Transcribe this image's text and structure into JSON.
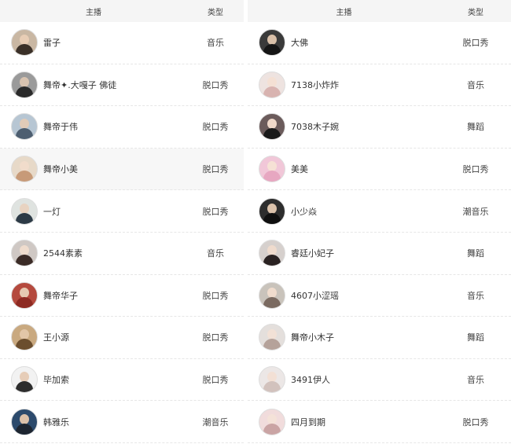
{
  "left_table": {
    "header": {
      "host": "主播",
      "type": "类型"
    },
    "rows": [
      {
        "name": "雷子",
        "type": "音乐",
        "avatar": {
          "bg": "#c9b7a3",
          "skin": "#e8cdb5",
          "cloth": "#3a3028"
        }
      },
      {
        "name": "舞帝✦.大嘎子 佛徒",
        "type": "脱口秀",
        "avatar": {
          "bg": "#9a9a9a",
          "skin": "#d8c3b0",
          "cloth": "#2a2a2a"
        }
      },
      {
        "name": "舞帝于伟",
        "type": "脱口秀",
        "avatar": {
          "bg": "#b7c6d3",
          "skin": "#e1cbb8",
          "cloth": "#4d5e70"
        }
      },
      {
        "name": "舞帝小美",
        "type": "脱口秀",
        "avatar": {
          "bg": "#e7d9c8",
          "skin": "#f1dccb",
          "cloth": "#c79a78"
        }
      },
      {
        "name": "一灯",
        "type": "脱口秀",
        "avatar": {
          "bg": "#dfe3e0",
          "skin": "#e8d3c1",
          "cloth": "#2c3a46"
        }
      },
      {
        "name": "2544素素",
        "type": "音乐",
        "avatar": {
          "bg": "#cfc8c4",
          "skin": "#efdccd",
          "cloth": "#3b2b26"
        }
      },
      {
        "name": "舞帝华子",
        "type": "脱口秀",
        "avatar": {
          "bg": "#b54a3e",
          "skin": "#e6c9b1",
          "cloth": "#8e2a22"
        }
      },
      {
        "name": "王小源",
        "type": "脱口秀",
        "avatar": {
          "bg": "#c9a980",
          "skin": "#e2c6a8",
          "cloth": "#6b4e2e"
        }
      },
      {
        "name": "毕加索",
        "type": "脱口秀",
        "avatar": {
          "bg": "#f2f2f2",
          "skin": "#e6cdb8",
          "cloth": "#2d2d2d"
        }
      },
      {
        "name": "韩雅乐",
        "type": "潮音乐",
        "avatar": {
          "bg": "#2c4a6c",
          "skin": "#dcc1a9",
          "cloth": "#1d2530"
        }
      }
    ]
  },
  "right_table": {
    "header": {
      "host": "主播",
      "type": "类型"
    },
    "rows": [
      {
        "name": "大佛",
        "type": "脱口秀",
        "avatar": {
          "bg": "#3a3a3a",
          "skin": "#d9c0a9",
          "cloth": "#151515"
        }
      },
      {
        "name": "7138小炸炸",
        "type": "音乐",
        "avatar": {
          "bg": "#eee3e0",
          "skin": "#f4e0d4",
          "cloth": "#d8b3b0"
        }
      },
      {
        "name": "7038木子婉",
        "type": "舞蹈",
        "avatar": {
          "bg": "#6b5b5b",
          "skin": "#efd8c9",
          "cloth": "#1a1a1a"
        }
      },
      {
        "name": "美美",
        "type": "脱口秀",
        "avatar": {
          "bg": "#f1c7d8",
          "skin": "#f6e1d5",
          "cloth": "#e7a7c1"
        }
      },
      {
        "name": "小少焱",
        "type": "潮音乐",
        "avatar": {
          "bg": "#2d2d2d",
          "skin": "#dbc2ab",
          "cloth": "#0f0f0f"
        }
      },
      {
        "name": "睿廷小妃子",
        "type": "舞蹈",
        "avatar": {
          "bg": "#d6d0cd",
          "skin": "#efdbcd",
          "cloth": "#2a2222"
        }
      },
      {
        "name": "4607小涩瑶",
        "type": "音乐",
        "avatar": {
          "bg": "#c9c3bb",
          "skin": "#f0dccd",
          "cloth": "#7a6a60"
        }
      },
      {
        "name": "舞帝小木子",
        "type": "舞蹈",
        "avatar": {
          "bg": "#e4dfdc",
          "skin": "#f2e1d6",
          "cloth": "#b5a29a"
        }
      },
      {
        "name": "3491伊人",
        "type": "音乐",
        "avatar": {
          "bg": "#ece7e6",
          "skin": "#f3e0d5",
          "cloth": "#d2c2bd"
        }
      },
      {
        "name": "四月到期",
        "type": "脱口秀",
        "avatar": {
          "bg": "#f1dcdc",
          "skin": "#f4e2d8",
          "cloth": "#caa4a4"
        }
      }
    ]
  }
}
